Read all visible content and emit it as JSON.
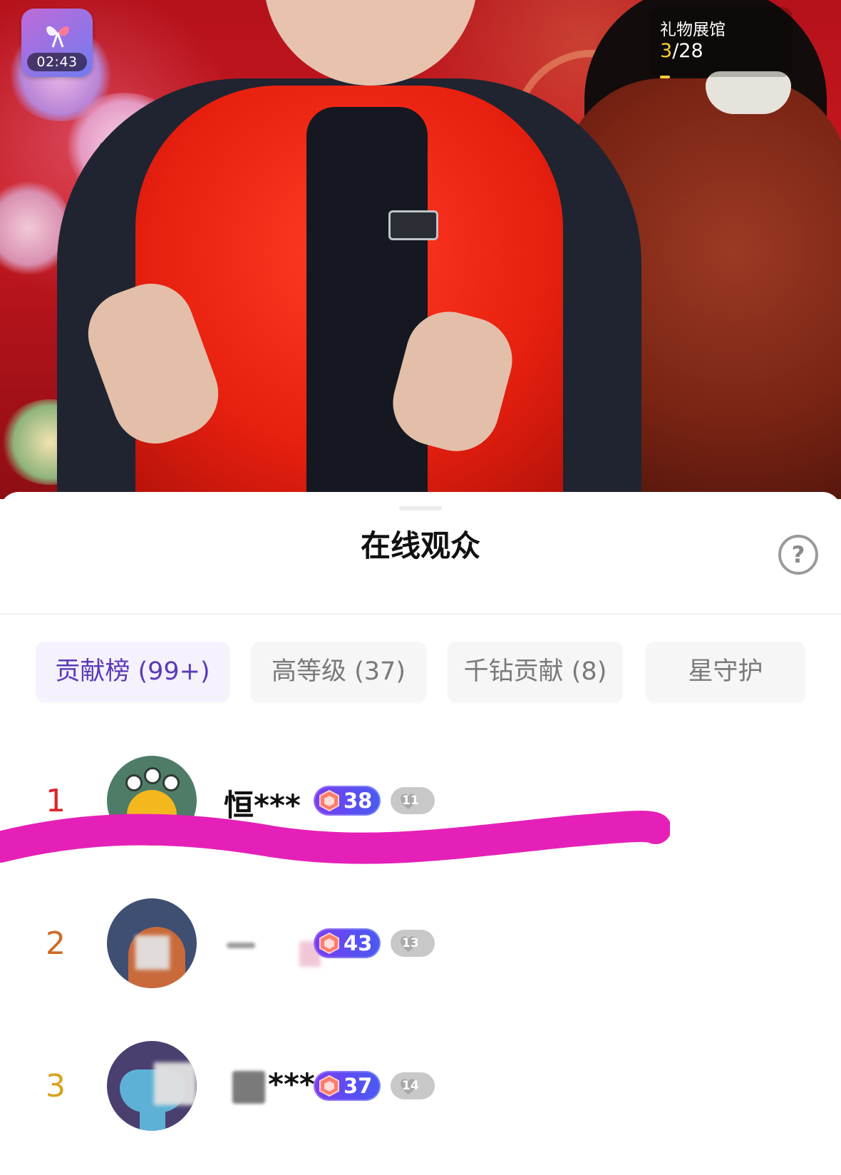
{
  "video": {
    "timer": "02:43",
    "gift_hall": {
      "label": "礼物展馆",
      "current": "3",
      "total": "/28"
    }
  },
  "sheet": {
    "title": "在线观众",
    "help_icon": "?",
    "tabs": [
      {
        "label": "贡献榜 (99+)",
        "active": true
      },
      {
        "label": "高等级 (37)",
        "active": false
      },
      {
        "label": "千钻贡献 (8)",
        "active": false
      },
      {
        "label": "星守护",
        "active": false
      }
    ],
    "rows": [
      {
        "rank": "1",
        "name": "恒***",
        "level": "38",
        "fan_level": "11"
      },
      {
        "rank": "2",
        "name": "",
        "level": "43",
        "fan_level": "13"
      },
      {
        "rank": "3",
        "name": "***",
        "level": "37",
        "fan_level": "14"
      }
    ]
  },
  "colors": {
    "active_tab_text": "#5b3ab8",
    "active_tab_bg": "#f5f1fd",
    "rank1": "#d9262b",
    "rank2": "#d06a24",
    "rank3": "#d9a21a",
    "level_badge": "#6a45f0",
    "marker": "#e520b8"
  },
  "icons": {
    "timer_badge": "gift-bow-icon",
    "help": "question-circle-icon",
    "level": "hexagon-gem-icon",
    "fan": "heart-icon"
  }
}
